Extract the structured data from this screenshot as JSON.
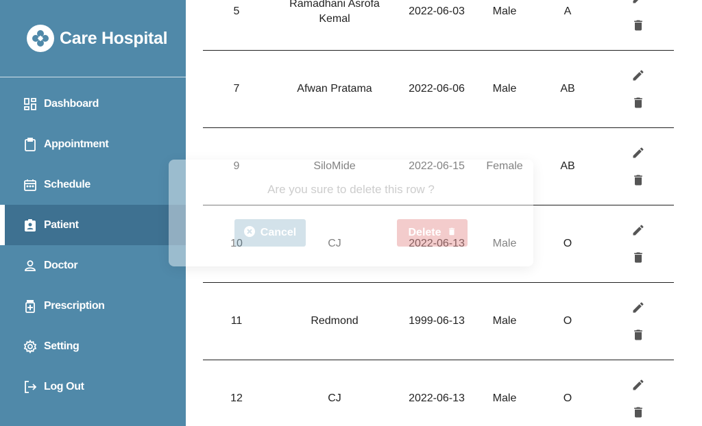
{
  "sidebar": {
    "brand": {
      "title": "Care Hospital"
    },
    "items": [
      {
        "label": "Dashboard",
        "icon": "dashboard-icon"
      },
      {
        "label": "Appointment",
        "icon": "clipboard-icon"
      },
      {
        "label": "Schedule",
        "icon": "calendar-icon"
      },
      {
        "label": "Patient",
        "icon": "patient-badge-icon",
        "active": true
      },
      {
        "label": "Doctor",
        "icon": "user-icon"
      },
      {
        "label": "Prescription",
        "icon": "medicine-icon"
      },
      {
        "label": "Setting",
        "icon": "gear-icon"
      },
      {
        "label": "Log Out",
        "icon": "logout-icon"
      }
    ]
  },
  "table": {
    "rows": [
      {
        "id": "5",
        "name": "Ramadhani Asrofa Kemal",
        "date": "2022-06-03",
        "gender": "Male",
        "blood": "A"
      },
      {
        "id": "7",
        "name": "Afwan Pratama",
        "date": "2022-06-06",
        "gender": "Male",
        "blood": "AB"
      },
      {
        "id": "9",
        "name": "SiloMide",
        "date": "2022-06-15",
        "gender": "Female",
        "blood": "AB"
      },
      {
        "id": "10",
        "name": "CJ",
        "date": "2022-06-13",
        "gender": "Male",
        "blood": "O"
      },
      {
        "id": "11",
        "name": "Redmond",
        "date": "1999-06-13",
        "gender": "Male",
        "blood": "O"
      },
      {
        "id": "12",
        "name": "CJ",
        "date": "2022-06-13",
        "gender": "Male",
        "blood": "O"
      }
    ]
  },
  "dialog": {
    "message": "Are you sure to delete this row ?",
    "cancel_label": "Cancel",
    "delete_label": "Delete"
  },
  "colors": {
    "sidebar_bg": "#5089a9",
    "text": "#222222",
    "icon": "#555555",
    "cancel_bg": "#a8c6d6",
    "delete_bg": "#e99a9a"
  }
}
